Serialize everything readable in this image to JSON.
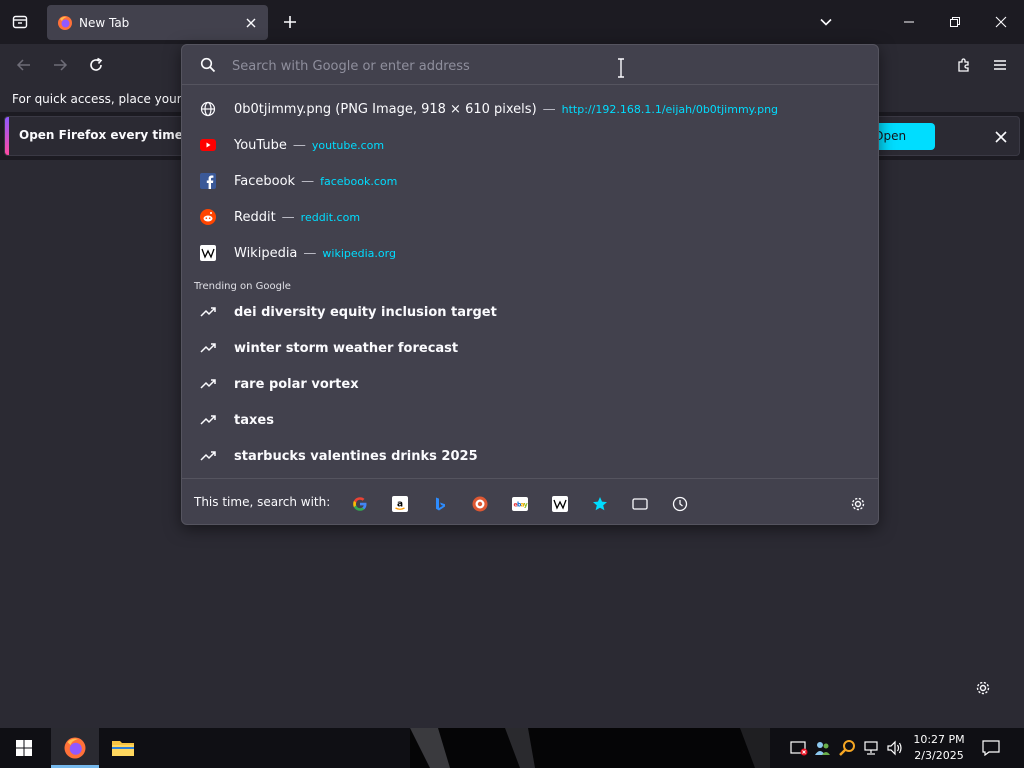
{
  "browser": {
    "tab": {
      "title": "New Tab",
      "favicon": "firefox-logo-icon"
    },
    "bookmarks_hint": "For quick access, place your bookmarks here on the bookmarks toolbar.",
    "notification": {
      "text": "Open Firefox every time you start your computer",
      "button_label": "Open Firefox"
    }
  },
  "urlbar": {
    "placeholder": "Search with Google or enter address",
    "value": "",
    "results": [
      {
        "icon": "globe-icon",
        "title": "0b0tjimmy.png (PNG Image, 918 × 610 pixels)",
        "separator": "—",
        "url": "http://192.168.1.1/eijah/0b0tjimmy.png"
      },
      {
        "icon": "youtube-icon",
        "title": "YouTube",
        "separator": "—",
        "url": "youtube.com"
      },
      {
        "icon": "facebook-icon",
        "title": "Facebook",
        "separator": "—",
        "url": "facebook.com"
      },
      {
        "icon": "reddit-icon",
        "title": "Reddit",
        "separator": "—",
        "url": "reddit.com"
      },
      {
        "icon": "wikipedia-icon",
        "title": "Wikipedia",
        "separator": "—",
        "url": "wikipedia.org"
      }
    ],
    "trending_label": "Trending on Google",
    "trending": [
      {
        "icon": "trending-icon",
        "text": "dei diversity equity inclusion target"
      },
      {
        "icon": "trending-icon",
        "text": "winter storm weather forecast"
      },
      {
        "icon": "trending-icon",
        "text": "rare polar vortex"
      },
      {
        "icon": "trending-icon",
        "text": "taxes"
      },
      {
        "icon": "trending-icon",
        "text": "starbucks valentines drinks 2025"
      }
    ],
    "oneoff_label": "This time, search with:",
    "oneoff_engines": [
      "google-icon",
      "amazon-icon",
      "bing-icon",
      "duckduckgo-icon",
      "ebay-icon",
      "wikipedia-icon",
      "bookmarks-icon",
      "tabs-icon",
      "history-icon"
    ]
  },
  "taskbar": {
    "time": "10:27 PM",
    "date": "2/3/2025"
  },
  "colors": {
    "accent": "#00ddff",
    "panel": "#42414d",
    "toolbar": "#2b2a33",
    "tabstrip": "#1c1b22"
  }
}
